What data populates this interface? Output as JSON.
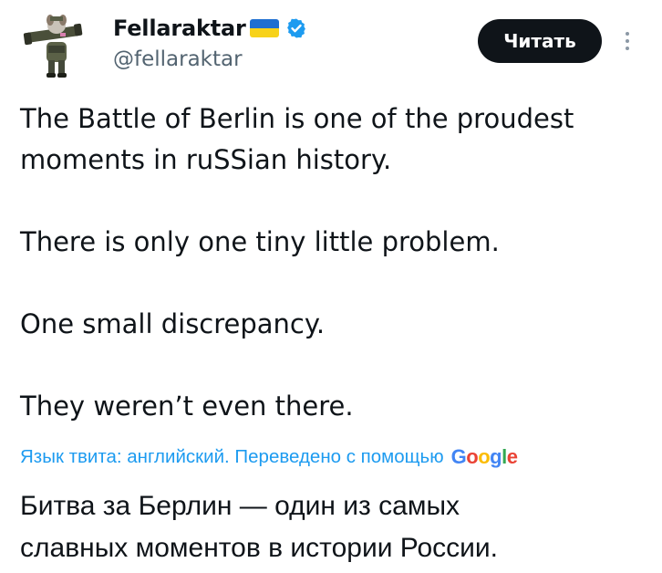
{
  "author": {
    "display_name": "Fellaraktar",
    "handle": "@fellaraktar",
    "avatar_icon": "cartoon-dog-soldier-avatar",
    "flag_icon": "ukraine-flag-icon",
    "verified_icon": "verified-badge-icon"
  },
  "actions": {
    "follow_label": "Читать",
    "more_icon": "vertical-ellipsis-icon"
  },
  "tweet": {
    "lines": [
      "The Battle of Berlin is one of the proudest",
      "moments in ruSSian history.",
      "There is only one tiny little problem.",
      "One small discrepancy.",
      "They weren’t even there."
    ]
  },
  "translation": {
    "note": "Язык твита: английский. Переведено с помощью",
    "provider": "Google",
    "lines": [
      "Битва за Берлин — один из самых",
      "славных моментов в истории России."
    ]
  },
  "colors": {
    "text": "#0f1419",
    "muted": "#536471",
    "link": "#1d9bf0",
    "button_bg": "#0f1419",
    "flag_blue": "#1f6fd1",
    "flag_yellow": "#f7d21a",
    "verified": "#1d9bf0"
  }
}
